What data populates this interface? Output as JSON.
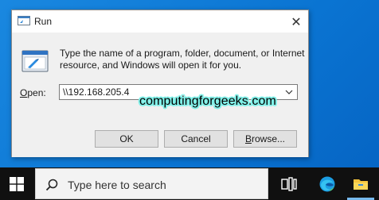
{
  "window": {
    "title": "Run",
    "close_glyph": "✕"
  },
  "dialog": {
    "description_line1": "Type the name of a program, folder, document, or Internet",
    "description_line2": "resource, and Windows will open it for you.",
    "open_label_accel": "O",
    "open_label_rest": "pen:",
    "open_value": "\\\\192.168.205.4"
  },
  "buttons": {
    "ok": "OK",
    "cancel": "Cancel",
    "browse_accel": "B",
    "browse_rest": "rowse..."
  },
  "watermark": "computingforgeeks.com",
  "taskbar": {
    "search_placeholder": "Type here to search",
    "icons": [
      "windows-start-icon",
      "search-icon",
      "task-view-icon",
      "edge-icon",
      "file-explorer-icon"
    ]
  },
  "colors": {
    "desktop": "#0a78d7",
    "taskbar": "#101010",
    "watermark_outline": "#7ff0e8"
  }
}
